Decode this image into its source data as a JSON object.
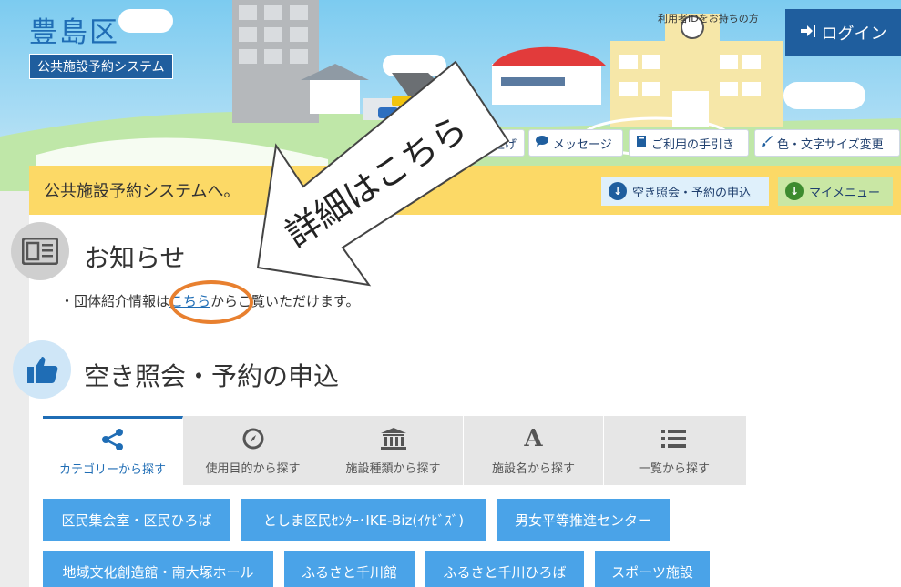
{
  "header": {
    "ward_name": "豊島区",
    "system_name": "公共施設予約システム",
    "login_note": "利用者IDをお持ちの方",
    "login_label": "ログイン",
    "buttons": [
      {
        "name": "font-size-up-button",
        "label": "上げ"
      },
      {
        "name": "message-button",
        "label": "メッセージ"
      },
      {
        "name": "guide-button",
        "label": "ご利用の手引き"
      },
      {
        "name": "color-text-size-button",
        "label": "色・文字サイズ変更"
      }
    ]
  },
  "welcome": {
    "text": "公共施設予約システムへ。",
    "availability_label": "空き照会・予約の申込",
    "mymenu_label": "マイメニュー"
  },
  "notice": {
    "title": "お知らせ",
    "text_before": "・団体紹介情報は",
    "link_text": "こちら",
    "text_after": "からご覧いただけます。"
  },
  "callout": {
    "text": "詳細はこちら",
    "color": "#e8802f"
  },
  "reservation": {
    "title": "空き照会・予約の申込",
    "tabs": [
      {
        "label": "カテゴリーから探す",
        "icon": "share-icon"
      },
      {
        "label": "使用目的から探す",
        "icon": "compass-icon"
      },
      {
        "label": "施設種類から探す",
        "icon": "bank-icon"
      },
      {
        "label": "施設名から探す",
        "icon": "letter-a-icon"
      },
      {
        "label": "一覧から探す",
        "icon": "list-icon"
      }
    ],
    "categories": [
      "区民集会室・区民ひろば",
      "としま区民ｾﾝﾀｰ･IKE-Biz(ｲｹﾋﾞｽﾞ)",
      "男女平等推進センター",
      "地域文化創造館・南大塚ホール",
      "ふるさと千川館",
      "ふるさと千川ひろば",
      "スポーツ施設"
    ]
  },
  "colors": {
    "brand_blue": "#1f5e9e",
    "button_blue": "#4aa3e8",
    "welcome_yellow": "#fcd966",
    "callout_orange": "#e8802f"
  }
}
